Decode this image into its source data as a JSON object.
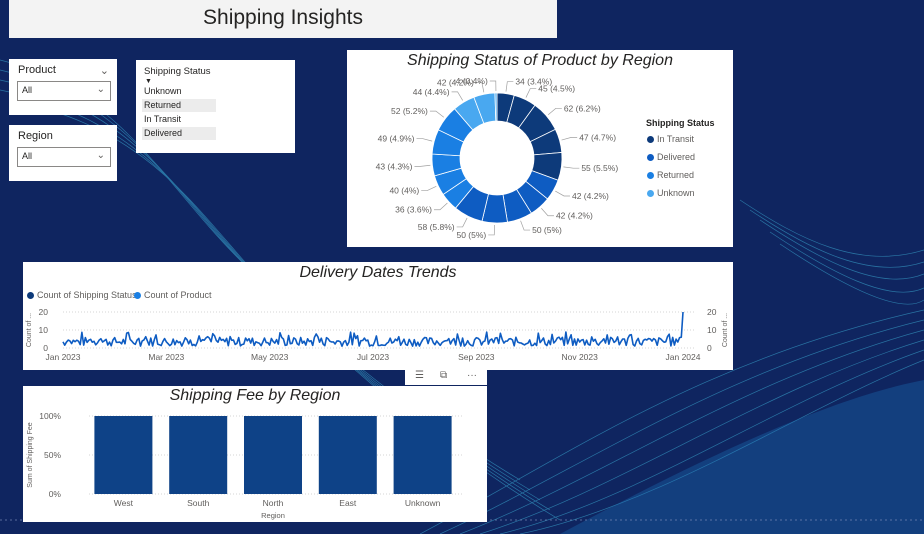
{
  "page": {
    "title": "Shipping Insights"
  },
  "slicers": {
    "product": {
      "label": "Product",
      "value": "All"
    },
    "region": {
      "label": "Region",
      "value": "All"
    },
    "shipping_status": {
      "label": "Shipping Status",
      "items": [
        "Unknown",
        "Returned",
        "In Transit",
        "Delivered"
      ]
    }
  },
  "colors": {
    "background": "#0f2560",
    "in_transit": "#0d3a7a",
    "delivered": "#0e5cc2",
    "returned": "#1a7fe3",
    "unknown": "#49a8f0",
    "bar": "#0e4287"
  },
  "toolbar": {
    "icons": [
      "filter-icon",
      "focus-mode-icon",
      "more-options-icon"
    ]
  },
  "chart_data": [
    {
      "type": "pie",
      "title": "Shipping Status of Product by Region",
      "legend_title": "Shipping Status",
      "legend_position": "right",
      "legend": [
        "In Transit",
        "Delivered",
        "Returned",
        "Unknown"
      ],
      "slices": [
        {
          "label": "34 (3.4%)",
          "value": 34,
          "status": "In Transit"
        },
        {
          "label": "45 (4.5%)",
          "value": 45,
          "status": "In Transit"
        },
        {
          "label": "62 (6.2%)",
          "value": 62,
          "status": "In Transit"
        },
        {
          "label": "47 (4.7%)",
          "value": 47,
          "status": "In Transit"
        },
        {
          "label": "55 (5.5%)",
          "value": 55,
          "status": "In Transit"
        },
        {
          "label": "42 (4.2%)",
          "value": 42,
          "status": "Delivered"
        },
        {
          "label": "42 (4.2%)",
          "value": 42,
          "status": "Delivered"
        },
        {
          "label": "50 (5%)",
          "value": 50,
          "status": "Delivered"
        },
        {
          "label": "50 (5%)",
          "value": 50,
          "status": "Delivered"
        },
        {
          "label": "58 (5.8%)",
          "value": 58,
          "status": "Delivered"
        },
        {
          "label": "36 (3.6%)",
          "value": 36,
          "status": "Returned"
        },
        {
          "label": "40 (4%)",
          "value": 40,
          "status": "Returned"
        },
        {
          "label": "43 (4.3%)",
          "value": 43,
          "status": "Returned"
        },
        {
          "label": "49 (4.9%)",
          "value": 49,
          "status": "Returned"
        },
        {
          "label": "52 (5.2%)",
          "value": 52,
          "status": "Returned"
        },
        {
          "label": "44 (4.4%)",
          "value": 44,
          "status": "Unknown"
        },
        {
          "label": "42 (4.2%)",
          "value": 42,
          "status": "Unknown"
        },
        {
          "label": "4 (0.4%)",
          "value": 4,
          "status": "Unknown"
        }
      ]
    },
    {
      "type": "line",
      "title": "Delivery Dates Trends",
      "legend_position": "top-left",
      "series_names": [
        "Count of Shipping Status",
        "Count of Product"
      ],
      "x_ticks": [
        "Jan 2023",
        "Mar 2023",
        "May 2023",
        "Jul 2023",
        "Sep 2023",
        "Nov 2023",
        "Jan 2024"
      ],
      "y_ticks": [
        "0",
        "10",
        "20"
      ],
      "ylabel_left": "Count of ...",
      "ylabel_right": "Count of ...",
      "ylim": [
        0,
        20
      ],
      "y_end_value": 20
    },
    {
      "type": "bar",
      "title": "Shipping Fee by Region",
      "categories": [
        "West",
        "South",
        "North",
        "East",
        "Unknown"
      ],
      "values": [
        100,
        100,
        100,
        100,
        100
      ],
      "y_ticks": [
        "100%",
        "50%",
        "0%"
      ],
      "ylim": [
        0,
        100
      ],
      "xlabel": "Region",
      "ylabel": "Sum of Shipping Fee"
    }
  ]
}
